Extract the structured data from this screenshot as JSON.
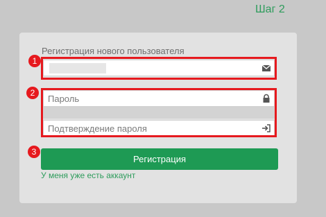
{
  "header": {
    "step_label": "Шаг 2"
  },
  "form": {
    "title": "Регистрация нового пользователя",
    "email": {
      "value": "",
      "placeholder": "",
      "icon": "envelope-icon"
    },
    "password": {
      "value": "",
      "placeholder": "Пароль",
      "icon": "lock-icon"
    },
    "password_confirm": {
      "value": "",
      "placeholder": "Подтверждение пароля",
      "icon": "sign-in-icon"
    },
    "submit_label": "Регистрация",
    "login_link": "У меня уже есть аккаунт"
  },
  "annotations": [
    {
      "number": "1"
    },
    {
      "number": "2"
    },
    {
      "number": "3"
    }
  ],
  "colors": {
    "accent": "#1e9a54",
    "link": "#2e9c5c",
    "annotation": "#e6191e",
    "panel": "#e2e2e2",
    "background": "#c8c8c8"
  }
}
